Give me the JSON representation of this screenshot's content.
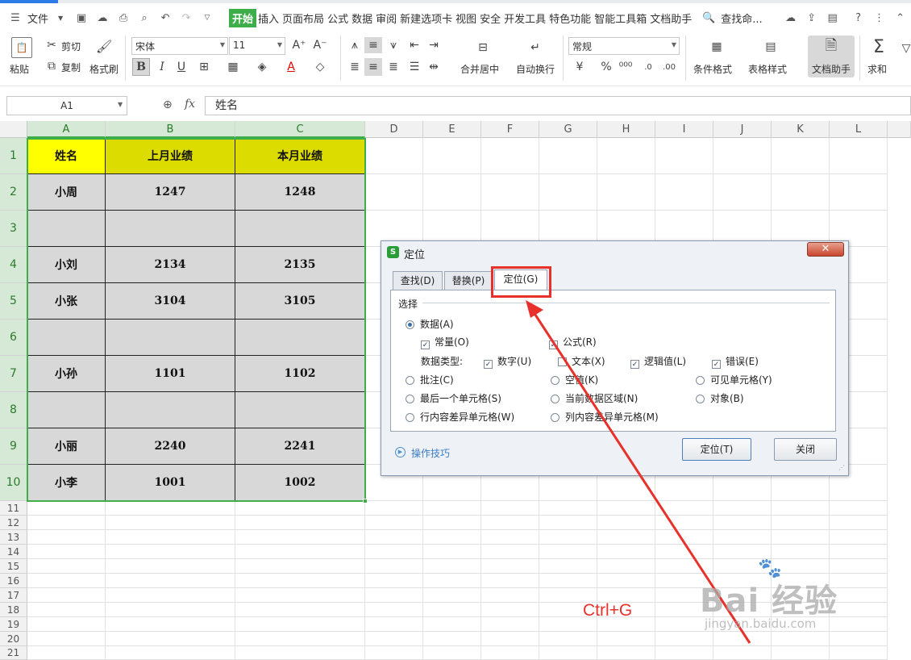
{
  "menu": {
    "file": "文件",
    "tabs": [
      "开始",
      "插入",
      "页面布局",
      "公式",
      "数据",
      "审阅",
      "新建选项卡",
      "视图",
      "安全",
      "开发工具",
      "特色功能",
      "智能工具箱",
      "文档助手"
    ],
    "search": "查找命..."
  },
  "ribbon": {
    "paste": "粘贴",
    "cut": "剪切",
    "copy": "复制",
    "format_painter": "格式刷",
    "font_name": "宋体",
    "font_size": "11",
    "font_grow": "A⁺",
    "font_shrink": "A⁻",
    "bold": "B",
    "italic": "I",
    "underline": "U",
    "merge_center": "合并居中",
    "wrap_text": "自动换行",
    "number_format": "常规",
    "conditional_format": "条件格式",
    "table_style": "表格样式",
    "doc_assistant": "文档助手",
    "sum": "求和"
  },
  "formula_bar": {
    "cell_ref": "A1",
    "fx": "fx",
    "value": "姓名"
  },
  "columns": [
    "A",
    "B",
    "C",
    "D",
    "E",
    "F",
    "G",
    "H",
    "I",
    "J",
    "K",
    "L"
  ],
  "rows": [
    "1",
    "2",
    "3",
    "4",
    "5",
    "6",
    "7",
    "8",
    "9",
    "10",
    "11",
    "12",
    "13",
    "14",
    "15",
    "16",
    "17",
    "18",
    "19",
    "20",
    "21"
  ],
  "table": {
    "headers": [
      "姓名",
      "上月业绩",
      "本月业绩"
    ],
    "rows": [
      [
        "小周",
        "1247",
        "1248"
      ],
      [
        "",
        "",
        ""
      ],
      [
        "小刘",
        "2134",
        "2135"
      ],
      [
        "小张",
        "3104",
        "3105"
      ],
      [
        "",
        "",
        ""
      ],
      [
        "小孙",
        "1101",
        "1102"
      ],
      [
        "",
        "",
        ""
      ],
      [
        "小丽",
        "2240",
        "2241"
      ],
      [
        "小李",
        "1001",
        "1002"
      ]
    ]
  },
  "dialog": {
    "title": "定位",
    "tabs": [
      "查找(D)",
      "替换(P)",
      "定位(G)"
    ],
    "group_label": "选择",
    "data": "数据(A)",
    "constant": "常量(O)",
    "formula": "公式(R)",
    "data_type_label": "数据类型:",
    "number": "数字(U)",
    "text": "文本(X)",
    "logical": "逻辑值(L)",
    "error": "错误(E)",
    "comments": "批注(C)",
    "blanks": "空值(K)",
    "visible_cells": "可见单元格(Y)",
    "last_cell": "最后一个单元格(S)",
    "current_region": "当前数据区域(N)",
    "objects": "对象(B)",
    "row_diff": "行内容差异单元格(W)",
    "col_diff": "列内容差异单元格(M)",
    "tips": "操作技巧",
    "locate_btn": "定位(T)",
    "close_btn": "关闭"
  },
  "annotation": {
    "shortcut": "Ctrl+G",
    "color": "#e8312a"
  },
  "watermark": {
    "brand": "Bai 经验",
    "url": "jingyan.baidu.com"
  },
  "colors": {
    "accent_green": "#3dae4a",
    "header_yellow": "#ffff00",
    "header_olive": "#dcdc00",
    "body_gray": "#d8d8d8",
    "arrow_red": "#e8312a"
  }
}
